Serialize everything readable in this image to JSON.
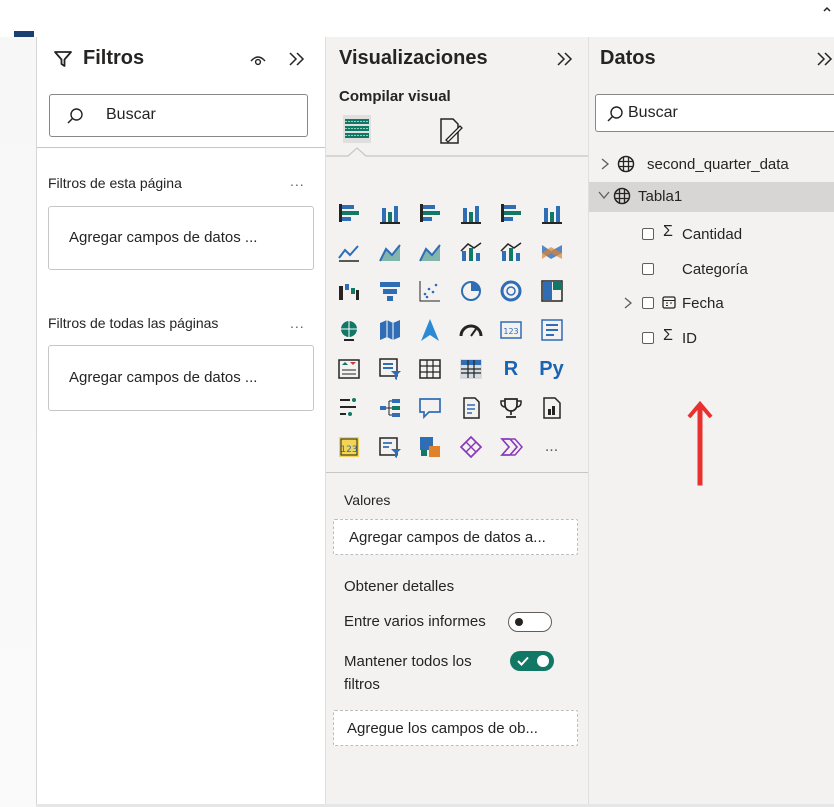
{
  "filters": {
    "title": "Filtros",
    "search_placeholder": "Buscar",
    "page_section": "Filtros de esta página",
    "page_drop": "Agregar campos de datos ...",
    "all_section": "Filtros de todas las páginas",
    "all_drop": "Agregar campos de datos ...",
    "more": "..."
  },
  "viz": {
    "title": "Visualizaciones",
    "build_label": "Compilar visual",
    "icons": [
      "stacked-bar-chart-icon",
      "stacked-column-chart-icon",
      "clustered-bar-chart-icon",
      "clustered-column-chart-icon",
      "100-stacked-bar-chart-icon",
      "100-stacked-column-chart-icon",
      "line-chart-icon",
      "area-chart-icon",
      "stacked-area-chart-icon",
      "line-and-stacked-column-chart-icon",
      "line-and-clustered-column-chart-icon",
      "ribbon-chart-icon",
      "waterfall-chart-icon",
      "funnel-chart-icon",
      "scatter-chart-icon",
      "pie-chart-icon",
      "donut-chart-icon",
      "treemap-icon",
      "map-icon",
      "filled-map-icon",
      "azure-map-icon",
      "gauge-icon",
      "card-icon",
      "multi-row-card-icon",
      "kpi-icon",
      "slicer-icon",
      "table-icon",
      "matrix-icon",
      "r-script-visual-icon",
      "python-visual-icon",
      "key-influencers-icon",
      "decomposition-tree-icon",
      "qa-icon",
      "smart-narrative-icon",
      "trophy-metrics-icon",
      "paginated-report-icon",
      "power-apps-icon",
      "power-automate-icon",
      "custom-visual-icon",
      "diamond-visual-icon",
      "chevron-visual-icon",
      "more-visuals-icon"
    ],
    "r_label": "R",
    "py_label": "Py",
    "more_label": "...",
    "values_label": "Valores",
    "values_drop": "Agregar campos de datos a...",
    "drill_label": "Obtener detalles",
    "cross_report": "Entre varios informes",
    "cross_report_on": false,
    "keep_filters_line1": "Mantener todos los",
    "keep_filters_line2": "filtros",
    "keep_filters_on": true,
    "drill_drop": "Agregue los campos de ob..."
  },
  "data": {
    "title": "Datos",
    "search_placeholder": "Buscar",
    "tables": [
      {
        "name": "second_quarter_data",
        "expanded": false
      },
      {
        "name": "Tabla1",
        "expanded": true
      }
    ],
    "fields": [
      {
        "name": "Cantidad",
        "sigma": true
      },
      {
        "name": "Categoría",
        "sigma": false
      },
      {
        "name": "Fecha",
        "sigma": false,
        "date": true
      },
      {
        "name": "ID",
        "sigma": true
      }
    ]
  },
  "colors": {
    "accent_green": "#117865",
    "annotation_arrow": "#e8312f",
    "panel_bg": "#f3f2f1"
  }
}
